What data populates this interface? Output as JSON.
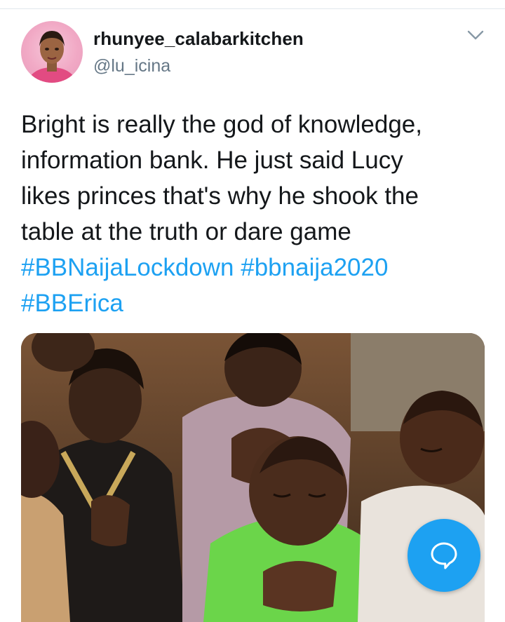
{
  "tweet": {
    "display_name": "rhunyee_calabarkitchen",
    "handle": "@lu_icina",
    "text_lines": [
      "Bright is really the god of knowledge,",
      "information bank. He just said Lucy",
      "likes princes that's why he shook the",
      "table at the truth or dare game"
    ],
    "hashtags": [
      "#BBNaijaLockdown",
      "#bbnaija2020",
      "#BBErica"
    ]
  },
  "icons": {
    "menu": "chevron-down-icon",
    "compose": "speech-bubble-icon"
  },
  "colors": {
    "accent": "#1da1f2",
    "text": "#14171a",
    "muted": "#657786",
    "divider": "#e1e8ed"
  }
}
